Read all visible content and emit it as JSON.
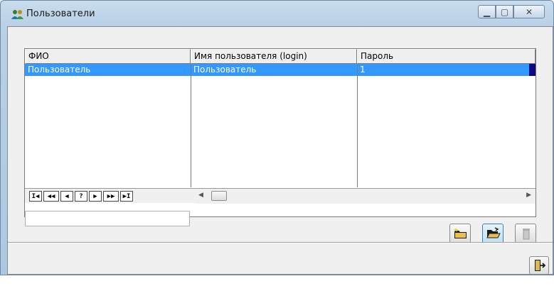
{
  "window": {
    "title": "Пользователи",
    "icon": "users-icon",
    "controls": {
      "minimize": "minimize-icon",
      "maximize": "maximize-icon",
      "close": "close-icon"
    }
  },
  "grid": {
    "columns": [
      "ФИО",
      "Имя пользователя (login)",
      "Пароль"
    ],
    "rows": [
      {
        "fio": "Пользователь",
        "login": "Пользователь",
        "password": "1",
        "selected": true
      }
    ],
    "selection_color": "#3399ff"
  },
  "navigator": {
    "buttons": [
      "I◀",
      "◀◀",
      "◀",
      "?",
      "▶",
      "▶▶",
      "▶I"
    ]
  },
  "filter": {
    "value": ""
  },
  "toolbar": {
    "add_icon": "folder-new-icon",
    "open_icon": "folder-open-icon",
    "delete_icon": "trash-icon"
  },
  "footer": {
    "exit_icon": "exit-door-icon"
  }
}
